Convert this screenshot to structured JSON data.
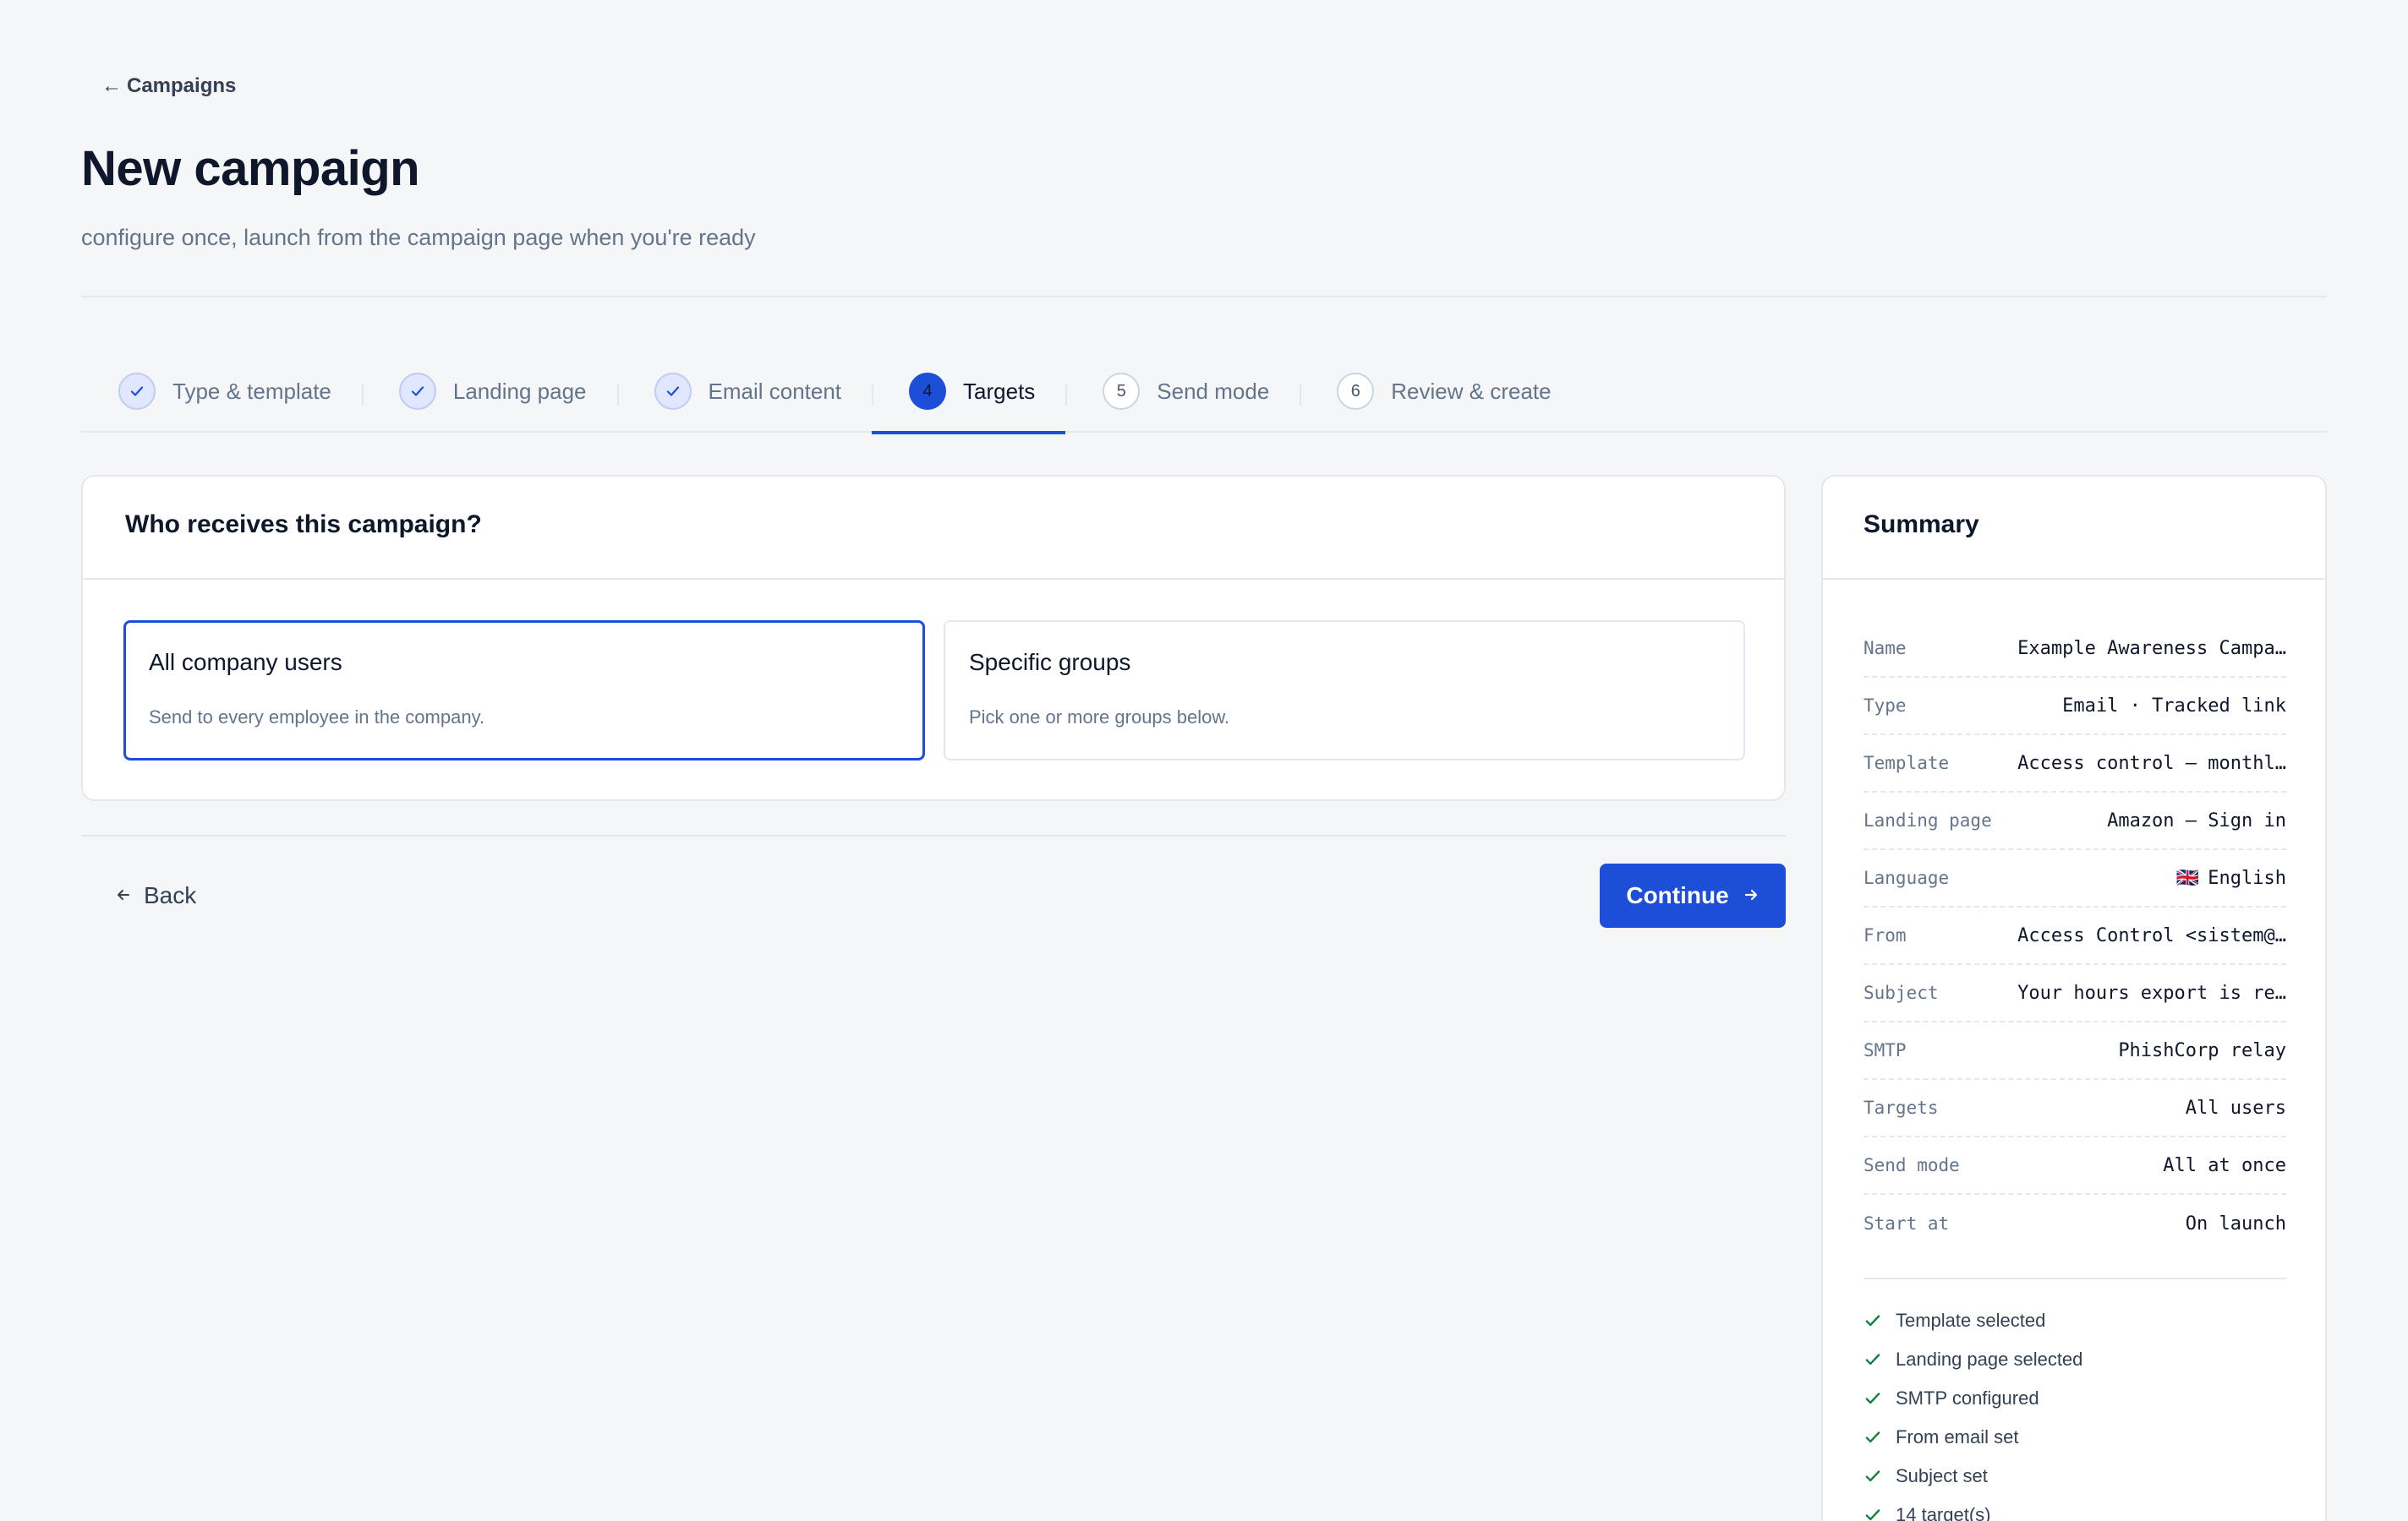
{
  "header": {
    "back_label": "Campaigns",
    "title": "New campaign",
    "subtitle": "configure once, launch from the campaign page when you're ready"
  },
  "stepper": {
    "steps": [
      {
        "label": "Type & template",
        "state": "done",
        "number": "1"
      },
      {
        "label": "Landing page",
        "state": "done",
        "number": "2"
      },
      {
        "label": "Email content",
        "state": "done",
        "number": "3"
      },
      {
        "label": "Targets",
        "state": "active",
        "number": "4"
      },
      {
        "label": "Send mode",
        "state": "todo",
        "number": "5"
      },
      {
        "label": "Review & create",
        "state": "todo",
        "number": "6"
      }
    ]
  },
  "targets": {
    "question": "Who receives this campaign?",
    "options": [
      {
        "title": "All company users",
        "description": "Send to every employee in the company.",
        "selected": true
      },
      {
        "title": "Specific groups",
        "description": "Pick one or more groups below.",
        "selected": false
      }
    ]
  },
  "footer": {
    "back_label": "Back",
    "continue_label": "Continue"
  },
  "summary": {
    "title": "Summary",
    "rows": [
      {
        "key": "Name",
        "value": "Example Awareness Campa…"
      },
      {
        "key": "Type",
        "value": "Email · Tracked link"
      },
      {
        "key": "Template",
        "value": "Access control — monthl…"
      },
      {
        "key": "Landing page",
        "value": "Amazon — Sign in"
      },
      {
        "key": "Language",
        "value": "English",
        "flag": "🇬🇧"
      },
      {
        "key": "From",
        "value": "Access Control <sistem@…"
      },
      {
        "key": "Subject",
        "value": "Your hours export is re…"
      },
      {
        "key": "SMTP",
        "value": "PhishCorp relay"
      },
      {
        "key": "Targets",
        "value": "All users"
      },
      {
        "key": "Send mode",
        "value": "All at once"
      },
      {
        "key": "Start at",
        "value": "On launch"
      }
    ],
    "checks": [
      "Template selected",
      "Landing page selected",
      "SMTP configured",
      "From email set",
      "Subject set",
      "14 target(s)"
    ]
  },
  "colors": {
    "accent": "#1d4ed8",
    "success": "#15803d",
    "background": "#f5f6f8"
  }
}
